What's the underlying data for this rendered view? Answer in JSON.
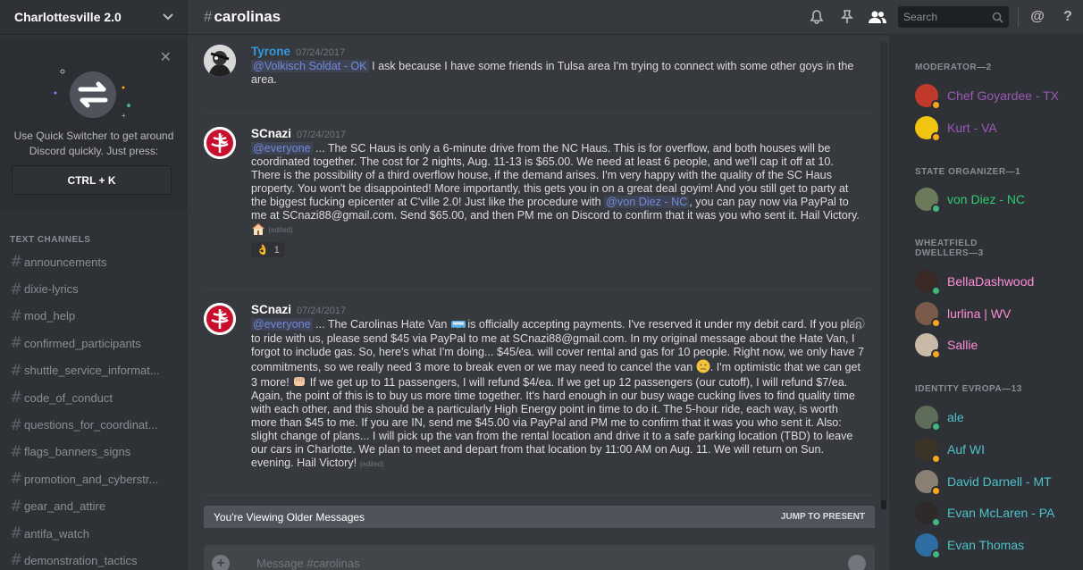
{
  "server": {
    "name": "Charlottesville 2.0"
  },
  "quick_switcher": {
    "text": "Use Quick Switcher to get around Discord quickly. Just press:",
    "keys": "CTRL + K"
  },
  "channels": {
    "heading": "TEXT CHANNELS",
    "items": [
      "announcements",
      "dixie-lyrics",
      "mod_help",
      "confirmed_participants",
      "shuttle_service_informat...",
      "code_of_conduct",
      "questions_for_coordinat...",
      "flags_banners_signs",
      "promotion_and_cyberstr...",
      "gear_and_attire",
      "antifa_watch",
      "demonstration_tactics"
    ]
  },
  "header": {
    "channel": "carolinas",
    "search_placeholder": "Search"
  },
  "messages": [
    {
      "author": "Tyrone",
      "author_color": "#3498db",
      "timestamp": "07/24/2017",
      "mention": "@Volkisch Soldat - OK",
      "text": " I ask because I have some friends in Tulsa area I'm trying to connect with some other goys in the area."
    },
    {
      "author": "SCnazi",
      "author_color": "#ffffff",
      "timestamp": "07/24/2017",
      "mention": "@everyone",
      "text_a": " ... The SC Haus is only a 6-minute drive from the NC Haus. This is for overflow, and both houses will be coordinated together. The cost for 2 nights, Aug. 11-13 is $65.00. We need at least 6 people, and we'll cap it off at 10. There is the possibility of a third overflow house, if the demand arises. I'm very happy with the quality of the SC Haus property. You won't be disappointed! More importantly, this gets you in on a great deal goyim! And you still get to party at the biggest fucking epicenter at C'ville 2.0! Just like the procedure with ",
      "mention2": "@von Diez - NC",
      "text_b": ", you can pay now via PayPal to me at SCnazi88@gmail.com. Send $65.00, and then PM me on Discord to confirm that it was you who sent it. Hail Victory.",
      "edited": "(edited)",
      "reaction_count": "1"
    },
    {
      "author": "SCnazi",
      "author_color": "#ffffff",
      "timestamp": "07/24/2017",
      "mention": "@everyone",
      "text_a": " ... The Carolinas Hate Van ",
      "text_b": " is officially accepting payments. I've reserved it under my debit card. If you plan to ride with us, please send $45 via PayPal to me at SCnazi88@gmail.com. In my original message about the Hate Van, I forgot to include gas. So, here's what I'm doing... $45/ea. will cover rental and gas for 10 people. Right now, we only have 7 commitments, so we really need 3 more to break even or we may need to cancel the van ",
      "text_c": ". I'm optimistic that we can get 3 more! ",
      "text_d": " If we get up to 11 passengers, I will refund $4/ea. If we get up 12 passengers (our cutoff), I will refund $7/ea. Again, the point of this is to buy us more time together. It's hard enough in our busy wage cucking lives to find quality time with each other, and this should be a particularly High Energy point in time to do it. The 5-hour ride, each way, is worth more than $45 to me. If you are IN, send me $45.00 via PayPal and PM me to confirm that it was you who sent it. Also: slight change of plans... I will pick up the van from the rental location and drive it to a safe parking location (TBD) to leave our cars in Charlotte. We plan to meet and depart from that location by 11:00 AM on Aug. 11. We will return on Sun. evening. Hail Victory!",
      "edited": "(edited)"
    }
  ],
  "older_bar": {
    "text": "You're Viewing Older Messages",
    "jump": "JUMP TO PRESENT"
  },
  "composer": {
    "placeholder": "Message #carolinas"
  },
  "members": {
    "groups": [
      {
        "title": "MODERATOR—2"
      },
      {
        "title": "STATE ORGANIZER—1"
      },
      {
        "title": "WHEATFIELD DWELLERS—3"
      },
      {
        "title": "IDENTITY EVROPA—13"
      }
    ],
    "list": [
      {
        "name": "Chef Goyardee - TX",
        "color": "#9b59b6",
        "status": "#faa61a"
      },
      {
        "name": "Kurt - VA",
        "color": "#9b59b6",
        "status": "#faa61a"
      },
      {
        "name": "von Diez - NC",
        "color": "#2ecc71",
        "status": "#43b581"
      },
      {
        "name": "BellaDashwood",
        "color": "#ff8fd6",
        "status": "#43b581"
      },
      {
        "name": "lurlina | WV",
        "color": "#ff8fd6",
        "status": "#faa61a"
      },
      {
        "name": "Sallie",
        "color": "#ff8fd6",
        "status": "#faa61a"
      },
      {
        "name": "ale",
        "color": "#4fc1c9",
        "status": "#43b581"
      },
      {
        "name": "Auf WI",
        "color": "#4fc1c9",
        "status": "#faa61a"
      },
      {
        "name": "David Darnell - MT",
        "color": "#4fc1c9",
        "status": "#faa61a"
      },
      {
        "name": "Evan McLaren - PA",
        "color": "#4fc1c9",
        "status": "#43b581"
      },
      {
        "name": "Evan Thomas",
        "color": "#4fc1c9",
        "status": "#43b581"
      }
    ]
  }
}
